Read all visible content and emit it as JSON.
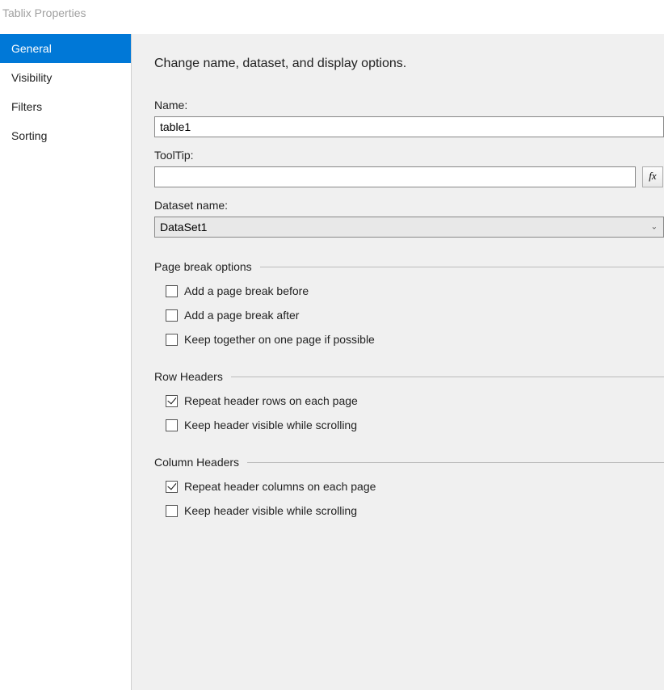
{
  "window": {
    "title": "Tablix Properties"
  },
  "sidebar": {
    "items": [
      {
        "label": "General",
        "selected": true
      },
      {
        "label": "Visibility",
        "selected": false
      },
      {
        "label": "Filters",
        "selected": false
      },
      {
        "label": "Sorting",
        "selected": false
      }
    ]
  },
  "heading": "Change name, dataset, and display options.",
  "fields": {
    "name_label": "Name:",
    "name_value": "table1",
    "tooltip_label": "ToolTip:",
    "tooltip_value": "",
    "dataset_label": "Dataset name:",
    "dataset_value": "DataSet1",
    "fx_label": "fx"
  },
  "groups": {
    "pagebreak": {
      "title": "Page break options",
      "items": [
        {
          "label": "Add a page break before",
          "checked": false
        },
        {
          "label": "Add a page break after",
          "checked": false
        },
        {
          "label": "Keep together on one page if possible",
          "checked": false
        }
      ]
    },
    "rowheaders": {
      "title": "Row Headers",
      "items": [
        {
          "label": "Repeat header rows on each page",
          "checked": true
        },
        {
          "label": "Keep header visible while scrolling",
          "checked": false
        }
      ]
    },
    "colheaders": {
      "title": "Column Headers",
      "items": [
        {
          "label": "Repeat header columns on each page",
          "checked": true
        },
        {
          "label": "Keep header visible while scrolling",
          "checked": false
        }
      ]
    }
  }
}
